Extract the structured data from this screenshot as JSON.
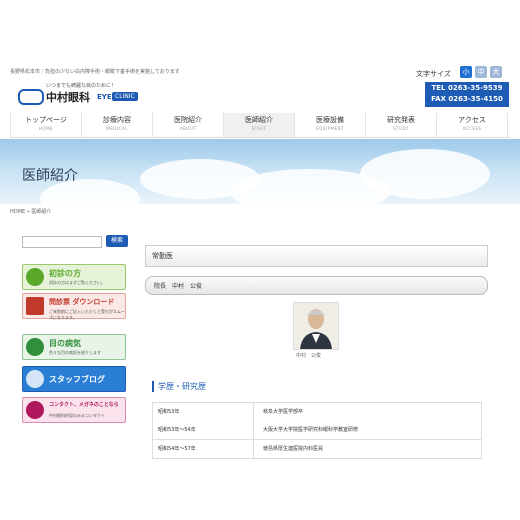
{
  "header": {
    "topline": "長野県松本市｜負担の少ない白内障手術・眼瞼下垂手術を実施しております",
    "font_size_label": "文字サイズ",
    "font_sizes": [
      "小",
      "中",
      "大"
    ],
    "tel": "TEL 0263-35-9539",
    "fax": "FAX 0263-35-4150"
  },
  "logo": {
    "tagline": "いつまでも綺麗な目のために！",
    "name": "中村眼科",
    "eye": "EYE",
    "clinic": "CLINIC"
  },
  "nav": [
    {
      "jp": "トップページ",
      "en": "HOME"
    },
    {
      "jp": "診療内容",
      "en": "MEDICAL"
    },
    {
      "jp": "医院紹介",
      "en": "ABOUT"
    },
    {
      "jp": "医師紹介",
      "en": "STAFF"
    },
    {
      "jp": "医療設備",
      "en": "EQUIPMENT"
    },
    {
      "jp": "研究発表",
      "en": "STUDY"
    },
    {
      "jp": "アクセス",
      "en": "ACCESS"
    }
  ],
  "page": {
    "title": "医師紹介",
    "breadcrumb": "HOME » 医師紹介"
  },
  "sidebar": {
    "search_button": "検索",
    "buttons": [
      {
        "title": "初診の方",
        "sub": "初診の方はまずご覧ください。",
        "color": "#5aa82a",
        "bg": "#e6f3d8"
      },
      {
        "title": "問診票 ダウンロード",
        "sub": "ご来院前にご記入いただくと受付がスムーズになります。",
        "color": "#c0392b",
        "bg": "#fbe9e7"
      },
      {
        "title": "目の病気",
        "sub": "色々な目の病気を紹介します",
        "color": "#2f8f3a",
        "bg": "#e8f4e8"
      },
      {
        "title": "スタッフブログ",
        "sub": "",
        "color": "#ffffff",
        "bg": "#2a7fd4"
      },
      {
        "title": "コンタクト、メガネのことなら",
        "sub": "中村眼科併設のみるコンタクト",
        "color": "#b0185e",
        "bg": "#fbe3ee"
      }
    ]
  },
  "main": {
    "section_title": "常勤医",
    "doctor_bar": "院長　中村　公俊",
    "doctor_caption": "中村　公俊",
    "career_heading": "学歴・研究歴",
    "career": [
      {
        "period": "昭和53年",
        "desc": "岐阜大学医学部卒"
      },
      {
        "period": "昭和53年～54年",
        "desc": "大阪大学大学院医学研究科眼科学教室研修"
      },
      {
        "period": "昭和54年～57年",
        "desc": "徳島県厚生連医院内科医員"
      }
    ]
  }
}
